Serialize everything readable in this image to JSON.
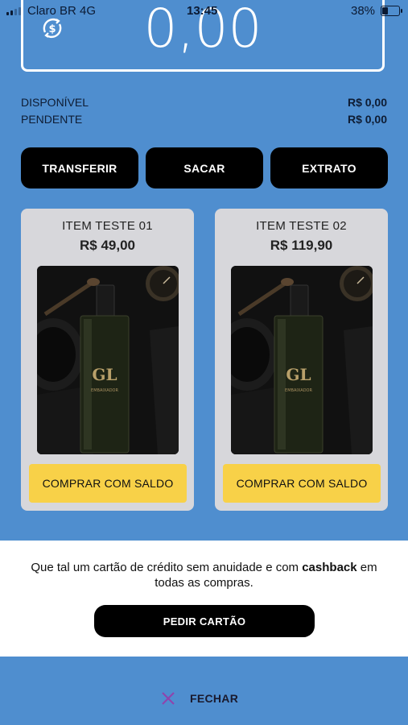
{
  "status_bar": {
    "carrier": "Claro BR  4G",
    "time": "13:45",
    "battery": "38%",
    "battery_level": 0.38
  },
  "balance": {
    "value": "0,00",
    "icon": "dollar-refresh-icon"
  },
  "summary": [
    {
      "label": "DISPONÍVEL",
      "value": "R$ 0,00"
    },
    {
      "label": "PENDENTE",
      "value": "R$ 0,00"
    }
  ],
  "actions": [
    "TRANSFERIR",
    "SACAR",
    "EXTRATO"
  ],
  "products": [
    {
      "name": "ITEM TESTE 01",
      "price": "R$ 49,00",
      "button": "COMPRAR COM SALDO"
    },
    {
      "name": "ITEM TESTE 02",
      "price": "R$ 119,90",
      "button": "COMPRAR COM SALDO"
    }
  ],
  "promo": {
    "text_before": "Que tal um cartão de crédito sem anuidade e com ",
    "text_bold": "cashback",
    "text_after": " em todas as compras.",
    "button": "PEDIR CARTÃO"
  },
  "close": {
    "label": "FECHAR",
    "icon": "close-icon"
  },
  "colors": {
    "background": "#4f8ecf",
    "button_dark": "#000000",
    "buy_button": "#f8d148",
    "card": "#d7d7db",
    "close_icon": "#8e44ad"
  }
}
